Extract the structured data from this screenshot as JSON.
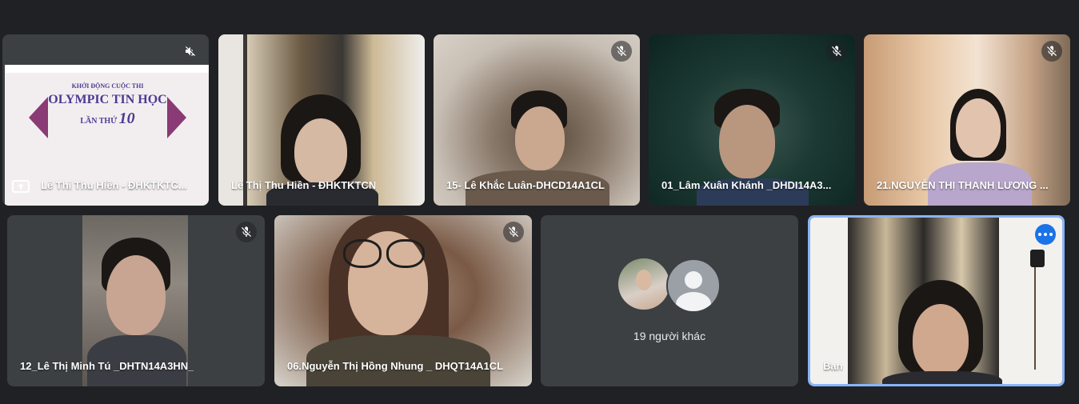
{
  "tiles": [
    {
      "name": "Lê Thị Thu Hiền - ĐHKTKTC...",
      "icon": "muted-speaker-icon",
      "presenting": true
    },
    {
      "name": "Lê Thị Thu Hiền - ĐHKTKTCN",
      "icon": "mic-off-icon"
    },
    {
      "name": "15- Lê Khắc Luân-DHCD14A1CL",
      "icon": "mic-off-icon"
    },
    {
      "name": "01_Lâm Xuân Khánh _DHDI14A3...",
      "icon": "mic-off-icon"
    },
    {
      "name": "21.NGUYỄN THỊ THANH LƯƠNG ...",
      "icon": "mic-off-icon"
    },
    {
      "name": "12_Lê Thị Minh Tú _DHTN14A3HN_",
      "icon": "mic-off-icon"
    },
    {
      "name": "06.Nguyễn Thị Hồng Nhung _ DHQT14A1CL",
      "icon": "mic-off-icon"
    },
    {
      "others_label": "19 người khác"
    },
    {
      "name": "Bạn",
      "icon": "more-options-icon"
    }
  ],
  "slide": {
    "line1": "KHỞI ĐỘNG CUỘC THI",
    "line2": "OLYMPIC TIN HỌC",
    "line3": "LẦN THỨ",
    "number": "10"
  },
  "colors": {
    "background": "#202124",
    "tile": "#3c4043",
    "accent": "#1a73e8"
  }
}
